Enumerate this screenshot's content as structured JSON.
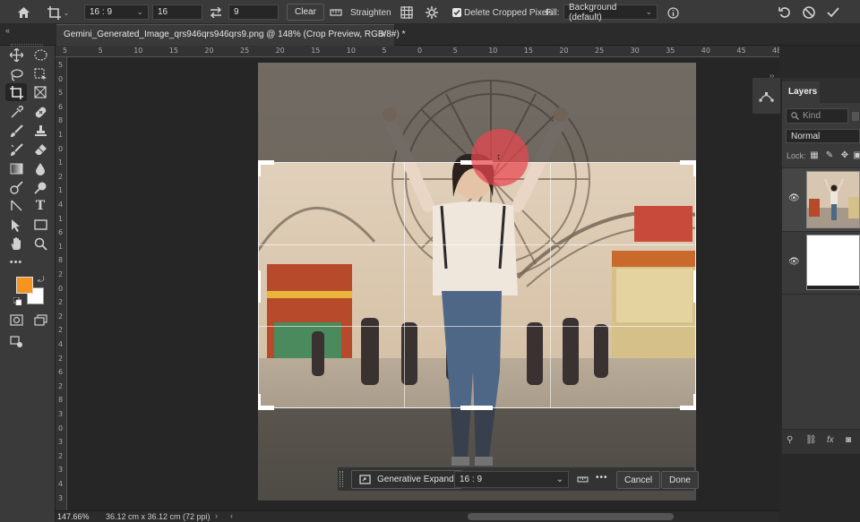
{
  "options_bar": {
    "ratio_select": "16 : 9",
    "width_value": "16",
    "height_value": "9",
    "clear_label": "Clear",
    "straighten_label": "Straighten",
    "delete_cropped_label": "Delete Cropped Pixels",
    "delete_cropped_checked": true,
    "fill_label": "Fill:",
    "fill_select": "Background (default)"
  },
  "document_tab": {
    "title": "Gemini_Generated_Image_qrs946qrs946qrs9.png @ 148% (Crop Preview, RGB/8#) *",
    "close": "×"
  },
  "rulers": {
    "horizontal": [
      "5",
      "5",
      "10",
      "15",
      "20",
      "25",
      "20",
      "15",
      "10",
      "5",
      "0",
      "5",
      "10",
      "15",
      "20",
      "25",
      "30",
      "35",
      "40",
      "45",
      "48"
    ],
    "vertical": [
      "5",
      "0",
      "5",
      "6",
      "8",
      "1",
      "0",
      "1",
      "2",
      "1",
      "4",
      "1",
      "6",
      "1",
      "8",
      "2",
      "0",
      "2",
      "2",
      "2",
      "4",
      "2",
      "6",
      "2",
      "8",
      "3",
      "0",
      "3",
      "2",
      "3",
      "4",
      "3"
    ]
  },
  "status_bar": {
    "zoom": "147.66%",
    "doc_size": "36.12 cm x 36.12 cm (72 ppi)"
  },
  "context_bar": {
    "generative_expand_label": "Generative Expand",
    "ratio_select": "16 : 9",
    "more": "•••",
    "cancel_label": "Cancel",
    "done_label": "Done"
  },
  "layers_panel": {
    "tab_label": "Layers",
    "search_placeholder": "Kind",
    "blend_mode": "Normal",
    "lock_label": "Lock:",
    "footer_fx": "fx"
  },
  "colors": {
    "foreground": "#f7941d",
    "background": "#ffffff",
    "crop_pin": "#e8474f"
  }
}
